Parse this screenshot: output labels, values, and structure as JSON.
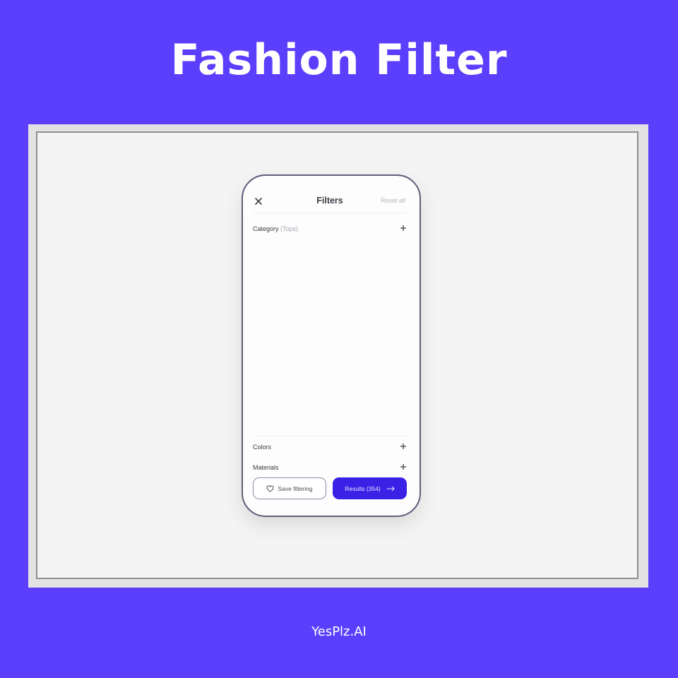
{
  "headline": "Fashion Filter",
  "brand": "YesPlz.AI",
  "phone": {
    "title": "Filters",
    "reset_label": "Reset all",
    "close_icon": "close-icon",
    "sections": {
      "category": {
        "label": "Category",
        "value": "(Tops)"
      },
      "colors": {
        "label": "Colors"
      },
      "materials": {
        "label": "Materials"
      }
    },
    "save_button": {
      "label": "Save filtering",
      "icon": "heart-icon"
    },
    "results_button": {
      "label": "Results (354)",
      "icon": "arrow-right-icon"
    }
  },
  "colors": {
    "background": "#5b3ffd",
    "accent": "#3a21e6",
    "frame": "#e3e3e3"
  }
}
